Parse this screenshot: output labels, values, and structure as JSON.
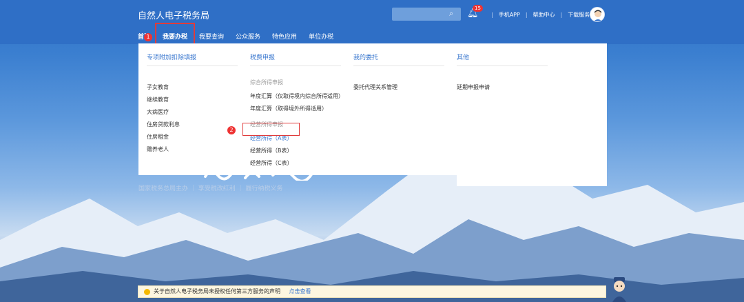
{
  "header": {
    "brand": "自然人电子税务局",
    "notification_count": "15",
    "links": [
      "手机APP",
      "帮助中心",
      "下载服务"
    ]
  },
  "nav": {
    "items": [
      "首页",
      "我要办税",
      "我要查询",
      "公众服务",
      "特色应用",
      "单位办税"
    ],
    "active": "我要办税"
  },
  "steps": {
    "step1": "1",
    "step2": "2"
  },
  "menu": {
    "col1": {
      "title": "专项附加扣除填报",
      "items": [
        "子女教育",
        "继续教育",
        "大病医疗",
        "住房贷款利息",
        "住房租金",
        "赡养老人"
      ]
    },
    "col2": {
      "title": "税费申报",
      "group1_label": "综合所得申报",
      "group1_items": [
        "年度汇算（仅取得境内综合所得适用）",
        "年度汇算（取得境外所得适用）"
      ],
      "group2_label": "经营所得申报",
      "group2_items": [
        "经营所得（A表）",
        "经营所得（B表）",
        "经营所得（C表）"
      ]
    },
    "col3": {
      "title": "我的委托",
      "items": [
        "委托代理关系管理"
      ]
    },
    "col4": {
      "title": "其他",
      "items": [
        "延期申报申请"
      ]
    }
  },
  "slogan": "国家税务总局主办 ｜ 享受税改红利 ｜ 履行纳税义务",
  "notice": {
    "text": "关于自然人电子税务局未授权任何第三方服务的声明",
    "link": "点击查看"
  },
  "icons": {
    "search": "search-icon",
    "bell": "bell-icon",
    "avatar": "avatar",
    "notice": "info-icon",
    "mascot": "mascot-icon"
  },
  "colors": {
    "primary": "#2f6fc6",
    "link": "#3b78cf",
    "highlight": "#e03b3b"
  }
}
